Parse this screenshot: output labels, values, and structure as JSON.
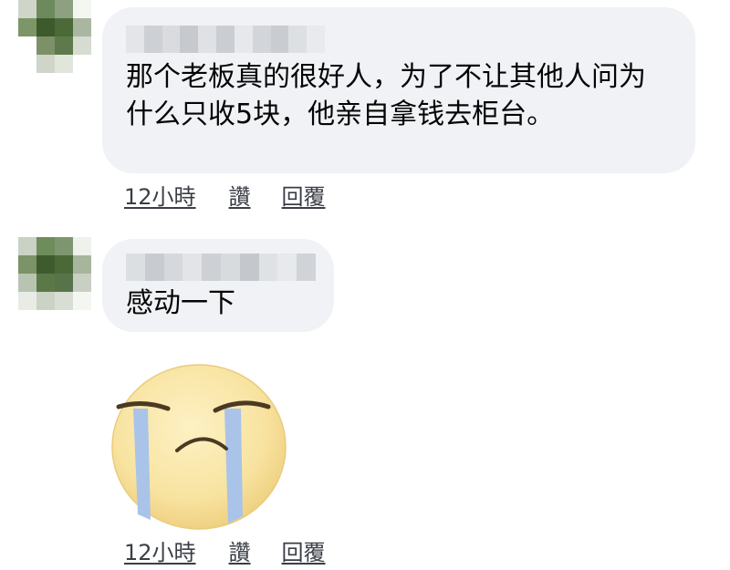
{
  "comments": [
    {
      "text": "那个老板真的很好人，为了不让其他人问为什么只收5块，他亲自拿钱去柜台。",
      "timestamp": "12小時",
      "like_label": "讚",
      "reply_label": "回覆"
    },
    {
      "text": "感动一下",
      "timestamp": "12小時",
      "like_label": "讚",
      "reply_label": "回覆",
      "sticker": "crying-face-icon"
    }
  ],
  "colors": {
    "bubble": "#f0f2f5",
    "text": "#050505",
    "meta": "#3a3e45",
    "sticker_face": "#f9e6a6",
    "tears": "#a9c4e8"
  }
}
